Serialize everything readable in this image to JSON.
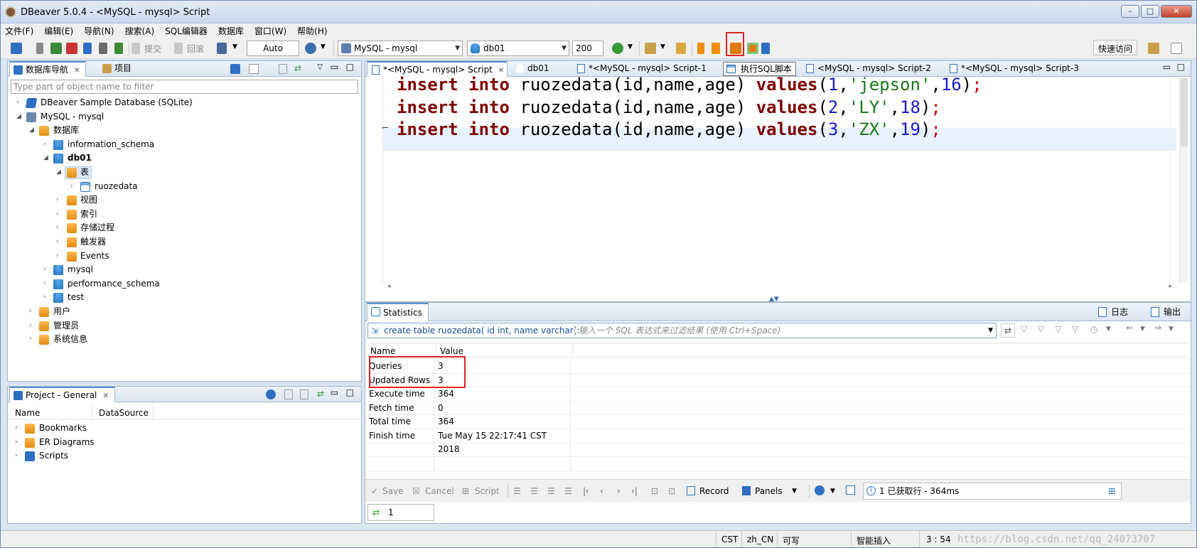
{
  "window": {
    "title": "DBeaver 5.0.4 - <MySQL - mysql> Script",
    "min": "–",
    "max": "□",
    "close": "✕"
  },
  "menu": [
    "文件(F)",
    "编辑(E)",
    "导航(N)",
    "搜索(A)",
    "SQL编辑器",
    "数据库",
    "窗口(W)",
    "帮助(H)"
  ],
  "toolbar": {
    "commit": "提交",
    "rollback": "回滚",
    "transaction_mode": "Auto",
    "datasource": "MySQL - mysql",
    "schema": "db01",
    "result_limit": "200",
    "quick_access": "快速访问"
  },
  "navigator": {
    "tabs": [
      "数据库导航",
      "项目"
    ],
    "filter_placeholder": "Type part of object name to filter",
    "tree": [
      "DBeaver Sample Database (SQLite)",
      "MySQL - mysql",
      "数据库",
      "information_schema",
      "db01",
      "表",
      "ruozedata",
      "视图",
      "索引",
      "存储过程",
      "触发器",
      "Events",
      "mysql",
      "performance_schema",
      "test",
      "用户",
      "管理员",
      "系统信息"
    ]
  },
  "project": {
    "tab": "Project - General",
    "columns": [
      "Name",
      "DataSource"
    ],
    "items": [
      "Bookmarks",
      "ER Diagrams",
      "Scripts"
    ]
  },
  "editor": {
    "tabs": [
      "*<MySQL - mysql> Script",
      "db01",
      "*<MySQL - mysql> Script-1",
      "<MySQL - mysql> Script-2",
      "*<MySQL - mysql> Script-3"
    ],
    "tooltip": "执行SQL脚本",
    "lines": [
      {
        "kw1": "insert",
        "kw2": "into",
        "body": " ruozedata(id,name,age) ",
        "kw3": "values",
        "id": "1",
        "name": "'jepson'",
        "age": "16"
      },
      {
        "kw1": "insert",
        "kw2": "into",
        "body": " ruozedata(id,name,age) ",
        "kw3": "values",
        "id": "2",
        "name": "'LY'",
        "age": "18"
      },
      {
        "kw1": "insert",
        "kw2": "into",
        "body": " ruozedata(id,name,age) ",
        "kw3": "values",
        "id": "3",
        "name": "'ZX'",
        "age": "19"
      }
    ]
  },
  "results": {
    "tab": "Statistics",
    "log_label": "日志",
    "output_label": "输出",
    "query_text": "create table ruozedata( id int, name varchar(:",
    "filter_placeholder": "输入一个 SQL 表达式来过滤结果 (使用 Ctrl+Space)",
    "columns": [
      "Name",
      "Value"
    ],
    "rows": [
      {
        "name": "Queries",
        "value": "3"
      },
      {
        "name": "Updated Rows",
        "value": "3"
      },
      {
        "name": "Execute time",
        "value": "364"
      },
      {
        "name": "Fetch time",
        "value": "0"
      },
      {
        "name": "Total time",
        "value": "364"
      },
      {
        "name": "Finish time",
        "value": "Tue May 15 22:17:41 CST 2018"
      }
    ],
    "buttons": {
      "save": "Save",
      "cancel": "Cancel",
      "script": "Script",
      "record": "Record",
      "panels": "Panels"
    },
    "status": "1 已获取行 - 364ms",
    "page_tab": "1"
  },
  "statusbar": {
    "tz": "CST",
    "locale": "zh_CN",
    "writable": "可写",
    "insert_mode": "智能插入",
    "position": "3 : 54",
    "watermark": "https://blog.csdn.net/qq_24073707"
  }
}
